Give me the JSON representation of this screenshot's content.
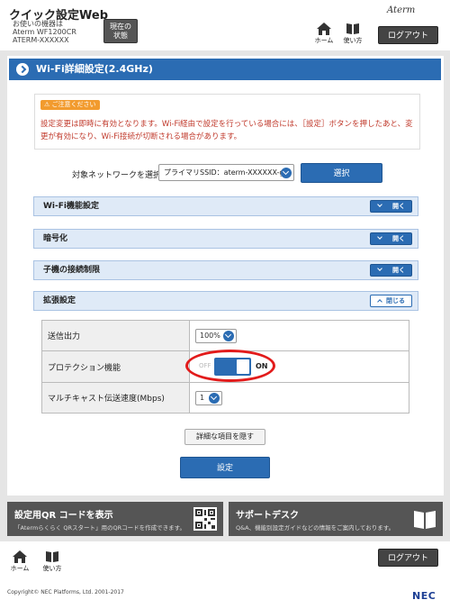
{
  "header": {
    "app_title": "クイック設定Web",
    "device_caption": "お使いの機器は",
    "model": "Aterm WF1200CR",
    "ssid": "ATERM-XXXXXX",
    "status_button": [
      "現在の",
      "状態"
    ],
    "brand_logo": "Aterm",
    "home_label": "ホーム",
    "manual_label": "使い方",
    "logout_label": "ログアウト"
  },
  "page": {
    "title": "Wi-Fi詳細設定(2.4GHz)"
  },
  "notice": {
    "badge": "ご注意ください",
    "text": "設定変更は即時に有効となります。Wi-Fi経由で設定を行っている場合には、［設定］ボタンを押したあと、変更が有効になり、Wi-Fi接続が切断される場合があります。"
  },
  "network_select": {
    "label": "対象ネットワークを選択",
    "value": "プライマリSSID：aterm-XXXXXX-g",
    "button": "選択"
  },
  "sections": [
    {
      "label": "Wi-Fi機能設定",
      "action": "開く",
      "state": "collapsed"
    },
    {
      "label": "暗号化",
      "action": "開く",
      "state": "collapsed"
    },
    {
      "label": "子機の接続制限",
      "action": "開く",
      "state": "collapsed"
    },
    {
      "label": "拡張設定",
      "action": "閉じる",
      "state": "expanded"
    }
  ],
  "extended_settings": {
    "tx_power": {
      "label": "送信出力",
      "value": "100%"
    },
    "protection": {
      "label": "プロテクション機能",
      "off_label": "OFF",
      "on_label": "ON",
      "state": "ON"
    },
    "multicast_rate": {
      "label": "マルチキャスト伝送速度(Mbps)",
      "value": "1"
    }
  },
  "actions": {
    "hide_details": "詳細な項目を隠す",
    "apply": "設定"
  },
  "links": {
    "qr": {
      "title": "設定用QR コードを表示",
      "subtitle": "「Atermらくらく QRスタート」用のQRコードを作成できます。"
    },
    "support": {
      "title": "サポートデスク",
      "subtitle": "Q&A、機能別設定ガイドなどの情報をご案内しております。"
    }
  },
  "footer": {
    "copyright": "Copyright© NEC Platforms, Ltd. 2001-2017",
    "logo": "NEC"
  },
  "colors": {
    "primary_blue": "#2b6cb3",
    "notice_red": "#c0392b",
    "badge_orange": "#f29b2e",
    "highlight_red": "#e21b1b"
  }
}
